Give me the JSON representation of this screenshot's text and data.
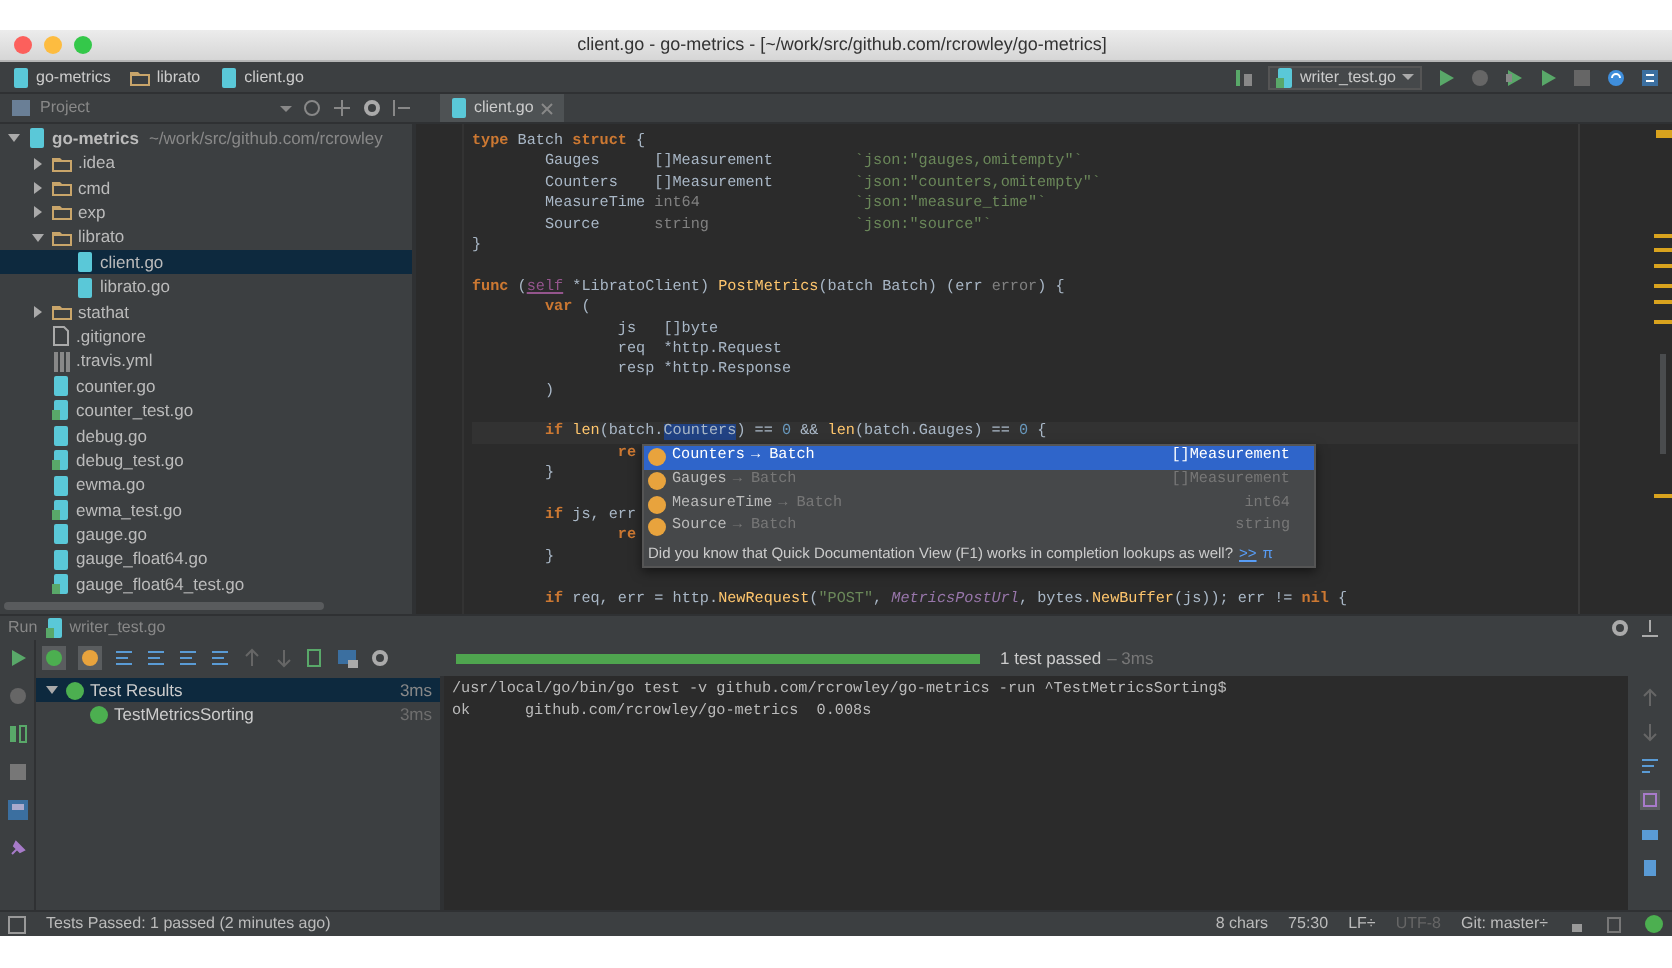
{
  "window": {
    "title": "client.go - go-metrics - [~/work/src/github.com/rcrowley/go-metrics]"
  },
  "breadcrumbs": [
    {
      "label": "go-metrics",
      "kind": "module"
    },
    {
      "label": "librato",
      "kind": "folder"
    },
    {
      "label": "client.go",
      "kind": "gofile"
    }
  ],
  "run_config": {
    "label": "writer_test.go"
  },
  "project_panel": {
    "title": "Project",
    "tree": [
      {
        "label": "go-metrics",
        "path": "~/work/src/github.com/rcrowley",
        "kind": "module",
        "expanded": true,
        "selected": false,
        "children": [
          {
            "label": ".idea",
            "kind": "folder",
            "expanded": false,
            "selected": false
          },
          {
            "label": "cmd",
            "kind": "folder",
            "expanded": false,
            "selected": false
          },
          {
            "label": "exp",
            "kind": "folder",
            "expanded": false,
            "selected": false
          },
          {
            "label": "librato",
            "kind": "folder",
            "expanded": true,
            "selected": false,
            "children": [
              {
                "label": "client.go",
                "kind": "gofile",
                "selected": true
              },
              {
                "label": "librato.go",
                "kind": "gofile",
                "selected": false
              }
            ]
          },
          {
            "label": "stathat",
            "kind": "folder",
            "expanded": false,
            "selected": false
          },
          {
            "label": ".gitignore",
            "kind": "text",
            "selected": false
          },
          {
            "label": ".travis.yml",
            "kind": "yml",
            "selected": false
          },
          {
            "label": "counter.go",
            "kind": "gofile",
            "selected": false
          },
          {
            "label": "counter_test.go",
            "kind": "testfile",
            "selected": false
          },
          {
            "label": "debug.go",
            "kind": "gofile",
            "selected": false
          },
          {
            "label": "debug_test.go",
            "kind": "testfile",
            "selected": false
          },
          {
            "label": "ewma.go",
            "kind": "gofile",
            "selected": false
          },
          {
            "label": "ewma_test.go",
            "kind": "testfile",
            "selected": false
          },
          {
            "label": "gauge.go",
            "kind": "gofile",
            "selected": false
          },
          {
            "label": "gauge_float64.go",
            "kind": "gofile",
            "selected": false
          },
          {
            "label": "gauge_float64_test.go",
            "kind": "testfile",
            "selected": false
          }
        ]
      }
    ]
  },
  "editor": {
    "tabs": [
      {
        "label": "client.go",
        "selected": true
      }
    ],
    "lines": [
      {
        "tokens": [
          {
            "text": "type",
            "kind": "keyword"
          },
          {
            "text": " Batch ",
            "kind": "plain"
          },
          {
            "text": "struct",
            "kind": "keyword"
          },
          {
            "text": " {",
            "kind": "plain"
          }
        ]
      },
      {
        "tokens": [
          {
            "text": "        Gauges      []Measurement         ",
            "kind": "plain"
          },
          {
            "text": "`json:\"gauges,omitempty\"`",
            "kind": "string"
          }
        ]
      },
      {
        "tokens": [
          {
            "text": "        Counters    []Measurement         ",
            "kind": "plain"
          },
          {
            "text": "`json:\"counters,omitempty\"`",
            "kind": "string"
          }
        ]
      },
      {
        "tokens": [
          {
            "text": "        MeasureTime ",
            "kind": "plain"
          },
          {
            "text": "int64",
            "kind": "type"
          },
          {
            "text": "                 `json:\"measure_time\"`",
            "kind": "string"
          }
        ]
      },
      {
        "tokens": [
          {
            "text": "        Source      ",
            "kind": "plain"
          },
          {
            "text": "string",
            "kind": "type"
          },
          {
            "text": "                `json:\"source\"`",
            "kind": "string"
          }
        ]
      },
      {
        "tokens": [
          {
            "text": "}",
            "kind": "plain"
          }
        ],
        "gap_after": true
      },
      {
        "tokens": [
          {
            "text": "func",
            "kind": "keyword"
          },
          {
            "text": " (",
            "kind": "plain"
          },
          {
            "text": "self",
            "kind": "receiver"
          },
          {
            "text": " *LibratoClient) ",
            "kind": "plain"
          },
          {
            "text": "PostMetrics",
            "kind": "function"
          },
          {
            "text": "(batch Batch) (err ",
            "kind": "plain"
          },
          {
            "text": "error",
            "kind": "type"
          },
          {
            "text": ") {",
            "kind": "plain"
          }
        ]
      },
      {
        "tokens": [
          {
            "text": "        var",
            "kind": "keyword"
          },
          {
            "text": " (",
            "kind": "plain"
          }
        ]
      },
      {
        "tokens": [
          {
            "text": "                js   []byte",
            "kind": "plain"
          }
        ]
      },
      {
        "tokens": [
          {
            "text": "                req  *http.Request",
            "kind": "plain"
          }
        ]
      },
      {
        "tokens": [
          {
            "text": "                resp *http.Response",
            "kind": "plain"
          }
        ]
      },
      {
        "tokens": [
          {
            "text": "        )",
            "kind": "plain"
          }
        ],
        "gap_after": true
      },
      {
        "current": true,
        "tokens": [
          {
            "text": "        if",
            "kind": "keyword"
          },
          {
            "text": " len",
            "kind": "function"
          },
          {
            "text": "(batch.",
            "kind": "plain"
          },
          {
            "text": "Counters",
            "kind": "selection"
          },
          {
            "text": ") == ",
            "kind": "plain"
          },
          {
            "text": "0",
            "kind": "number"
          },
          {
            "text": " && ",
            "kind": "plain"
          },
          {
            "text": "len",
            "kind": "function"
          },
          {
            "text": "(batch.Gauges) == ",
            "kind": "plain"
          },
          {
            "text": "0",
            "kind": "number"
          },
          {
            "text": " {",
            "kind": "plain"
          }
        ]
      },
      {
        "tokens": [
          {
            "text": "                re",
            "kind": "keyword"
          }
        ]
      },
      {
        "tokens": [
          {
            "text": "        }",
            "kind": "plain"
          }
        ],
        "gap_after": true
      },
      {
        "tokens": [
          {
            "text": "        if",
            "kind": "keyword"
          },
          {
            "text": " js, err",
            "kind": "plain"
          }
        ]
      },
      {
        "tokens": [
          {
            "text": "                re",
            "kind": "keyword"
          }
        ]
      },
      {
        "tokens": [
          {
            "text": "        }",
            "kind": "plain"
          }
        ],
        "gap_after": true
      },
      {
        "tokens": [
          {
            "text": "        if",
            "kind": "keyword"
          },
          {
            "text": " req, err = http.",
            "kind": "plain"
          },
          {
            "text": "NewRequest",
            "kind": "function"
          },
          {
            "text": "(",
            "kind": "plain"
          },
          {
            "text": "\"POST\"",
            "kind": "string"
          },
          {
            "text": ", ",
            "kind": "plain"
          },
          {
            "text": "MetricsPostUrl",
            "kind": "constant"
          },
          {
            "text": ", bytes.",
            "kind": "plain"
          },
          {
            "text": "NewBuffer",
            "kind": "function"
          },
          {
            "text": "(js)); err != ",
            "kind": "plain"
          },
          {
            "text": "nil",
            "kind": "keyword"
          },
          {
            "text": " {",
            "kind": "plain"
          }
        ]
      }
    ]
  },
  "completion": {
    "items": [
      {
        "name": "Counters",
        "owner": "→ Batch",
        "type": "[]Measurement",
        "selected": true
      },
      {
        "name": "Gauges",
        "owner": "→ Batch",
        "type": "[]Measurement",
        "selected": false
      },
      {
        "name": "MeasureTime",
        "owner": "→ Batch",
        "type": "int64",
        "selected": false
      },
      {
        "name": "Source",
        "owner": "→ Batch",
        "type": "string",
        "selected": false
      }
    ],
    "hint": "Did you know that Quick Documentation View (F1) works in completion lookups as well?",
    "hint_link": ">>",
    "hint_symbol": "π"
  },
  "run_panel": {
    "title": "Run",
    "config": "writer_test.go",
    "progress": {
      "level": 1
    },
    "summary": "1 test passed",
    "duration": "– 3ms",
    "tests": [
      {
        "label": "Test Results",
        "time": "3ms",
        "selected": true,
        "expanded": true,
        "children": [
          {
            "label": "TestMetricsSorting",
            "time": "3ms",
            "selected": false
          }
        ]
      }
    ],
    "console": [
      "/usr/local/go/bin/go test -v github.com/rcrowley/go-metrics -run ^TestMetricsSorting$",
      "ok      github.com/rcrowley/go-metrics  0.008s"
    ]
  },
  "status_bar": {
    "message": "Tests Passed: 1 passed (2 minutes ago)",
    "items": [
      {
        "label": "8 chars",
        "dim": false
      },
      {
        "label": "75:30",
        "dim": false
      },
      {
        "label": "LF÷",
        "dim": false
      },
      {
        "label": "UTF-8",
        "dim": true
      },
      {
        "label": "Git: master÷",
        "dim": false
      }
    ]
  }
}
